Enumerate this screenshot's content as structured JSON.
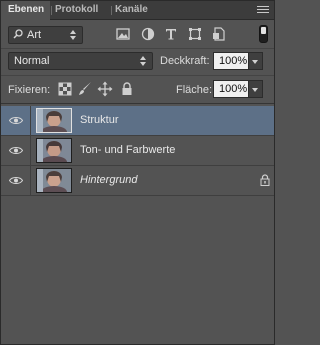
{
  "tabs": [
    "Ebenen",
    "Protokoll",
    "Kanäle"
  ],
  "filter": {
    "label": "Art"
  },
  "blend_mode": "Normal",
  "opacity": {
    "label": "Deckkraft:",
    "value": "100%"
  },
  "lock_label": "Fixieren:",
  "fill": {
    "label": "Fläche:",
    "value": "100%"
  },
  "layers": [
    {
      "name": "Struktur",
      "selected": true,
      "locked": false,
      "italic": false
    },
    {
      "name": "Ton- und Farbwerte",
      "selected": false,
      "locked": false,
      "italic": false
    },
    {
      "name": "Hintergrund",
      "selected": false,
      "locked": true,
      "italic": true
    }
  ],
  "colors": {
    "panel_bg": "#535353",
    "tabbar_bg": "#3c3c3c",
    "selected_row": "#5d7087",
    "field_bg": "#f0f0f0"
  },
  "icons": [
    "pixel-filter-icon",
    "adjustment-filter-icon",
    "type-filter-icon",
    "shape-filter-icon",
    "smart-object-filter-icon",
    "lock-transparent-icon",
    "lock-image-icon",
    "lock-position-icon",
    "lock-all-icon",
    "eye-icon",
    "lock-icon"
  ]
}
